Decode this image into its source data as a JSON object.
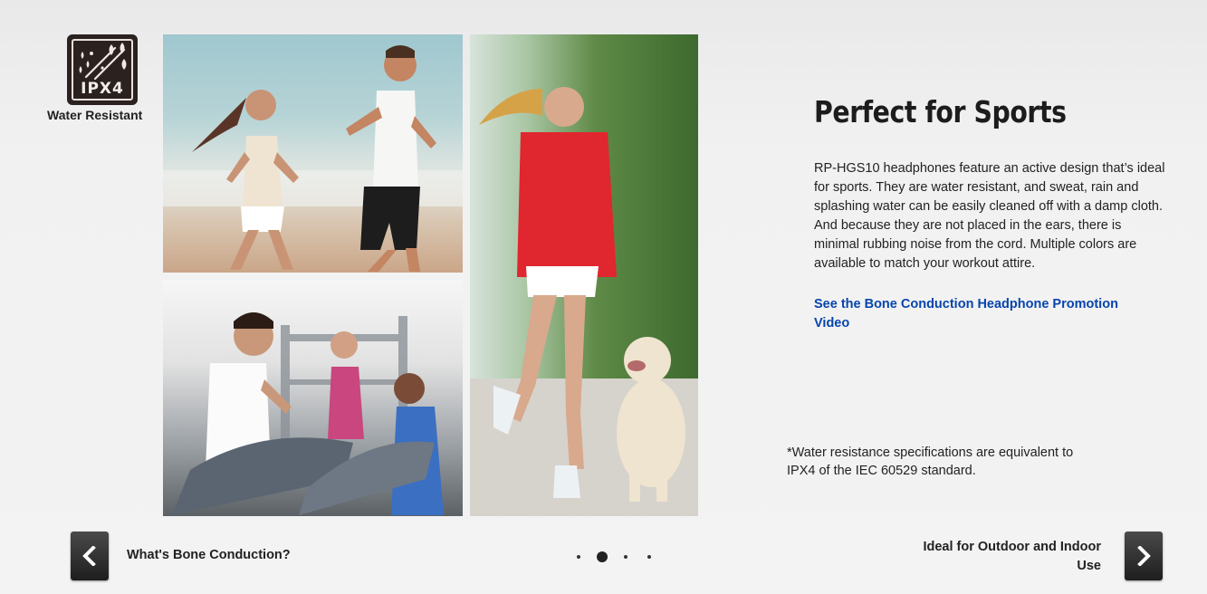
{
  "badge": {
    "rating": "IPX4",
    "caption": "Water Resistant"
  },
  "feature": {
    "title": "Perfect for Sports",
    "description": "RP-HGS10 headphones feature an active design that’s ideal for sports. They are water resistant, and sweat, rain and splashing water can be easily cleaned off with a damp cloth. And because they are not placed in the ears, there is minimal rubbing noise from the cord. Multiple colors are available to match your workout attire.",
    "link_text": "See the Bone Conduction Headphone Promotion Video",
    "footnote": "*Water resistance specifications are equivalent to\n IPX4 of the IEC 60529 standard."
  },
  "carousel": {
    "prev_label": "What's Bone Conduction?",
    "next_label": "Ideal for Outdoor and Indoor Use",
    "slide_count": 4,
    "active_slide": 2
  },
  "colors": {
    "link": "#0645ad",
    "nav_button": "#2a2a2a",
    "badge": "#2b2220"
  }
}
